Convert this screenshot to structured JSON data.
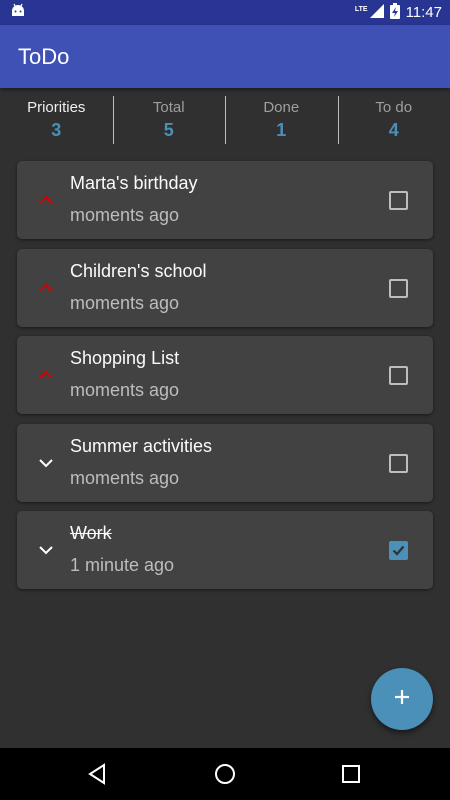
{
  "status_bar": {
    "time": "11:47",
    "network": "LTE",
    "icons": [
      "android-debug-icon",
      "lte-signal-icon",
      "battery-charging-icon"
    ]
  },
  "app_bar": {
    "title": "ToDo"
  },
  "stats": [
    {
      "label": "Priorities",
      "value": "3"
    },
    {
      "label": "Total",
      "value": "5"
    },
    {
      "label": "Done",
      "value": "1"
    },
    {
      "label": "To do",
      "value": "4"
    }
  ],
  "tasks": [
    {
      "title": "Marta's birthday",
      "time": "moments ago",
      "priority": "high",
      "done": false
    },
    {
      "title": "Children's school",
      "time": "moments ago",
      "priority": "high",
      "done": false
    },
    {
      "title": "Shopping List",
      "time": "moments ago",
      "priority": "high",
      "done": false
    },
    {
      "title": "Summer activities",
      "time": "moments ago",
      "priority": "low",
      "done": false
    },
    {
      "title": "Work",
      "time": "1 minute ago",
      "priority": "low",
      "done": true
    }
  ],
  "fab": {
    "icon": "plus-icon"
  },
  "colors": {
    "status_bar": "#283593",
    "app_bar": "#3f51b5",
    "background": "#303030",
    "card": "#424242",
    "accent": "#4a90b8",
    "high_priority": "#d50000"
  }
}
